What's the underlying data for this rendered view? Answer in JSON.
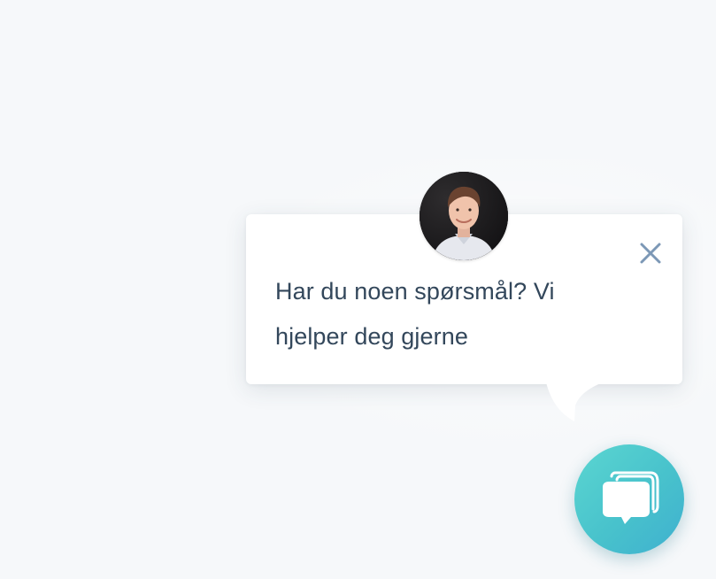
{
  "welcome_message": {
    "text": "Har du noen spørsmål? Vi hjelper deg gjerne"
  },
  "icons": {
    "close": "close-icon",
    "launcher": "chat-bubbles-icon",
    "avatar": "agent-avatar"
  },
  "colors": {
    "background": "#f6f8fa",
    "card": "#ffffff",
    "text": "#33475b",
    "close_icon": "#7c98b6",
    "launcher_start": "#5bd6d1",
    "launcher_end": "#3fb0cf"
  }
}
